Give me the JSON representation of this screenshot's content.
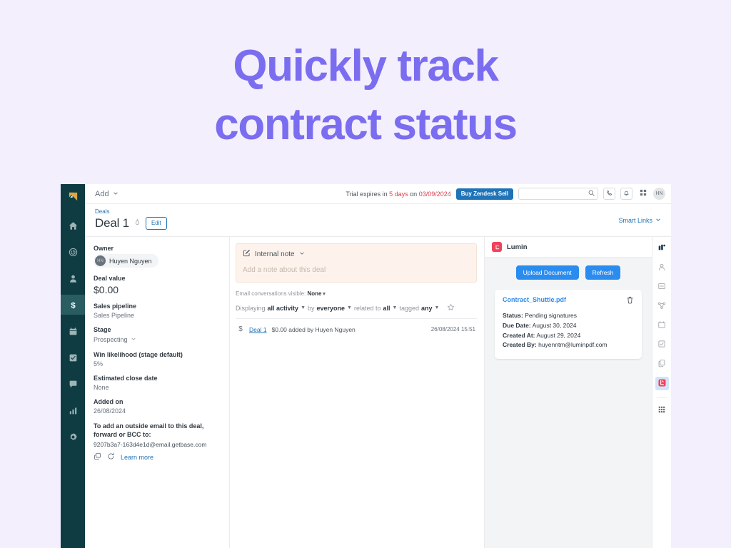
{
  "hero": {
    "line1": "Quickly track",
    "line2": "contract status",
    "color": "#7b6df0"
  },
  "nav_rail": {
    "logo_name": "zendesk-sell-logo",
    "items": [
      {
        "name": "home",
        "label": "Home"
      },
      {
        "name": "leads",
        "label": "Leads"
      },
      {
        "name": "contacts",
        "label": "Contacts"
      },
      {
        "name": "deals",
        "label": "Deals",
        "active": true
      },
      {
        "name": "calendar",
        "label": "Calendar"
      },
      {
        "name": "tasks",
        "label": "Tasks"
      },
      {
        "name": "communication",
        "label": "Communication"
      },
      {
        "name": "reports",
        "label": "Reports"
      },
      {
        "name": "settings",
        "label": "Settings"
      }
    ]
  },
  "topbar": {
    "add_label": "Add",
    "trial_prefix": "Trial expires in",
    "trial_days": "5 days",
    "trial_middle": "on",
    "trial_date": "03/09/2024",
    "buy_label": "Buy Zendesk Sell",
    "search_value": "",
    "search_placeholder": "",
    "avatar_initials": "HN"
  },
  "deal_header": {
    "breadcrumb": "Deals",
    "title": "Deal 1",
    "edit_label": "Edit",
    "smart_links_label": "Smart Links"
  },
  "detail": {
    "owner_label": "Owner",
    "owner_initials": "HN",
    "owner_name": "Huyen Nguyen",
    "deal_value_label": "Deal value",
    "deal_value": "$0.00",
    "pipeline_label": "Sales pipeline",
    "pipeline_value": "Sales Pipeline",
    "stage_label": "Stage",
    "stage_value": "Prospecting",
    "win_label": "Win likelihood (stage default)",
    "win_value": "5%",
    "close_date_label": "Estimated close date",
    "close_date_value": "None",
    "added_on_label": "Added on",
    "added_on_value": "26/08/2024",
    "bcc_label": "To add an outside email to this deal, forward or BCC to:",
    "bcc_email": "9207b3a7-163d4e1d@email.getbase.com",
    "learn_more_label": "Learn more"
  },
  "activity": {
    "note_type": "Internal note",
    "note_placeholder": "Add a note about this deal",
    "email_visibility_label": "Email conversations visible:",
    "email_visibility_value": "None",
    "displaying_prefix": "Displaying",
    "displaying_activity": "all activity",
    "by_prefix": "by",
    "by_value": "everyone",
    "related_prefix": "related to",
    "related_value": "all",
    "tagged_prefix": "tagged",
    "tagged_value": "any",
    "rows": [
      {
        "link": "Deal 1",
        "text": "$0.00 added by Huyen Nguyen",
        "time": "26/08/2024 15:51"
      }
    ]
  },
  "lumin": {
    "app_name": "Lumin",
    "upload_label": "Upload Document",
    "refresh_label": "Refresh",
    "document": {
      "file_name": "Contract_Shuttle.pdf",
      "status_label": "Status:",
      "status_value": "Pending signatures",
      "due_label": "Due Date:",
      "due_value": "August 30, 2024",
      "created_at_label": "Created At:",
      "created_at_value": "August 29, 2024",
      "created_by_label": "Created By:",
      "created_by_value": "huyenntm@luminpdf.com"
    }
  },
  "right_rail": {
    "items": [
      {
        "name": "overview",
        "label": "Overview"
      },
      {
        "name": "contacts",
        "label": "Contacts"
      },
      {
        "name": "notes",
        "label": "Notes"
      },
      {
        "name": "related",
        "label": "Related"
      },
      {
        "name": "calendar",
        "label": "Calendar"
      },
      {
        "name": "tasks",
        "label": "Tasks"
      },
      {
        "name": "documents",
        "label": "Documents"
      },
      {
        "name": "lumin",
        "label": "Lumin",
        "selected": true
      },
      {
        "name": "apps",
        "label": "Apps"
      }
    ]
  },
  "colors": {
    "page_bg": "#f3effd",
    "hero": "#7b6df0",
    "nav_dark": "#0e3c42",
    "accent_blue": "#1f73b7",
    "lumin_blue": "#2b8cf0",
    "lumin_red": "#f2415a",
    "trial_red": "#d93f4c",
    "note_bg": "#fdf3ec"
  }
}
